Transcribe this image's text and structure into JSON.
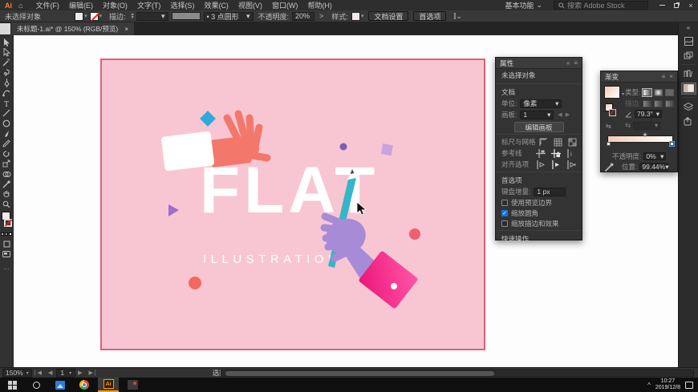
{
  "icons": {
    "chevron_down": "▾",
    "chevron_tiny": "⌄",
    "home": "⌂",
    "collapse": "«",
    "menu": "≡",
    "ellipsis": "…",
    "close": "×",
    "minimize": "–",
    "gt": ">",
    "first": "|◀",
    "prev": "◀",
    "next": "▶",
    "last": "▶|",
    "caret_up": "^",
    "check": "✓",
    "reverse": "⇆",
    "bullet_dot": "・"
  },
  "titlebar": {
    "logo": "Ai",
    "menus": [
      "文件(F)",
      "编辑(E)",
      "对象(O)",
      "文字(T)",
      "选择(S)",
      "效果(C)",
      "视图(V)",
      "窗口(W)",
      "帮助(H)"
    ],
    "workspace": "基本功能",
    "search_placeholder": "搜索 Adobe Stock"
  },
  "controlbar": {
    "no_selection": "未选择对象",
    "stroke_label": "描边:",
    "brush_value": "• 3 点圆形",
    "opacity_label": "不透明度:",
    "opacity_value": "20%",
    "style_label": "样式:",
    "doc_setup_btn": "文档设置",
    "prefs_btn": "首选项"
  },
  "tab": {
    "title": "未标题-1.ai* @ 150% (RGB/预览)"
  },
  "properties": {
    "tab_title": "属性",
    "no_selection": "未选择对象",
    "section_document": "文档",
    "unit_label": "单位:",
    "unit_value": "像素",
    "artboard_label": "画板:",
    "artboard_value": "1",
    "edit_artboards_btn": "编辑画板",
    "rulers_label": "标尺与网格",
    "guides_label": "参考线",
    "snap_label": "对齐选项",
    "section_prefs": "首选项",
    "kbd_label": "键盘增量:",
    "kbd_value": "1 px",
    "checkbox_preview_bounds": "使用预览边界",
    "checkbox_scale_corners": "缩放圆角",
    "checkbox_scale_strokes": "缩放描边和效果",
    "section_quick": "快速操作"
  },
  "gradient_panel": {
    "title": "渐变",
    "type_label": "类型:",
    "stroke_label": "描边:",
    "angle_value": "79.3°",
    "opacity_label": "不透明度:",
    "opacity_value": "0%",
    "position_label": "位置:",
    "position_value": "99.44%"
  },
  "artwork": {
    "headline": "FLAT",
    "subline": "ILLUSTRATION",
    "colors": {
      "artboard": "#F8C6D2",
      "artboard_border": "#DE5F7C",
      "coral": "#F4776C",
      "sleeve": "#FFFFFF",
      "purple": "#A78BD6",
      "cuff_from": "#FF57A8",
      "cuff_to": "#ED1578",
      "pencil": "#35B5C8",
      "pencil_tip": "#FFFFFF",
      "diamond": "#2FA8DC",
      "violet_dot": "#7A5FB5",
      "lavender_square": "#C9A3E0",
      "triangle": "#9A71CE",
      "pink_dot": "#F15F6D",
      "coral_dot": "#F4695D"
    }
  },
  "statusbar": {
    "zoom": "150%",
    "artboard_nav": "1",
    "tool": "选择"
  },
  "taskbar": {
    "time": "10:27",
    "date": "2019/12/8"
  }
}
